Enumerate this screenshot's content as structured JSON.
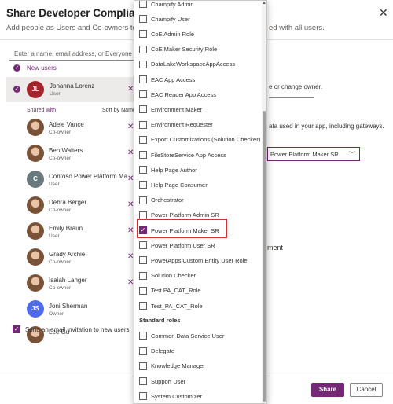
{
  "header": {
    "title": "Share Developer Compliance Cent",
    "subtitle_left": "Add people as Users and Co-owners to your app.",
    "subtitle_right": "ed with all users.",
    "close_glyph": "✕"
  },
  "people_panel": {
    "search_placeholder": "Enter a name, email address, or Everyone",
    "new_users_label": "New users",
    "selected_user": {
      "initials": "JL",
      "name": "Johanna Lorenz",
      "role": "User",
      "avatar_color": "#a4262c"
    },
    "shared_with_label": "Shared with",
    "sort_label": "Sort by Name",
    "shared": [
      {
        "name": "Adele Vance",
        "role": "Co-owner",
        "photo": true
      },
      {
        "name": "Ben Walters",
        "role": "Co-owner",
        "photo": true
      },
      {
        "name": "Contoso Power Platform Ma",
        "role": "User",
        "photo": false,
        "initials": "C",
        "avatar_color": "#69797e"
      },
      {
        "name": "Debra Berger",
        "role": "Co-owner",
        "photo": true
      },
      {
        "name": "Emily Braun",
        "role": "User",
        "photo": true
      },
      {
        "name": "Grady Archie",
        "role": "Co-owner",
        "photo": true
      },
      {
        "name": "Isaiah Langer",
        "role": "Co-owner",
        "photo": true
      },
      {
        "name": "Joni Sherman",
        "role": "Owner",
        "photo": false,
        "initials": "JS",
        "avatar_color": "#4f6bed"
      },
      {
        "name": "Lee Gu",
        "role": "",
        "photo": true
      }
    ],
    "email_invite_label": "Send an email invitation to new users",
    "remove_glyph": "✕"
  },
  "right_panel": {
    "text1": "e or change owner.",
    "text2": "ata used in your app, including gateways.",
    "selected_role": "Power Platform Maker SR",
    "partial_text": "ment"
  },
  "footer": {
    "share_label": "Share",
    "cancel_label": "Cancel"
  },
  "roles_dropdown": {
    "items": [
      {
        "label": "Champify Admin",
        "checked": false
      },
      {
        "label": "Champify User",
        "checked": false
      },
      {
        "label": "CoE Admin Role",
        "checked": false
      },
      {
        "label": "CoE Maker Security Role",
        "checked": false
      },
      {
        "label": "DataLakeWorkspaceAppAccess",
        "checked": false
      },
      {
        "label": "EAC App Access",
        "checked": false
      },
      {
        "label": "EAC Reader App Access",
        "checked": false
      },
      {
        "label": "Environment Maker",
        "checked": false
      },
      {
        "label": "Environment Requester",
        "checked": false
      },
      {
        "label": "Export Customizations (Solution Checker)",
        "checked": false
      },
      {
        "label": "FileStoreService App Access",
        "checked": false
      },
      {
        "label": "Help Page Author",
        "checked": false
      },
      {
        "label": "Help Page Consumer",
        "checked": false
      },
      {
        "label": "Orchestrator",
        "checked": false
      },
      {
        "label": "Power Platform Admin SR",
        "checked": false
      },
      {
        "label": "Power Platform Maker SR",
        "checked": true
      },
      {
        "label": "Power Platform User SR",
        "checked": false
      },
      {
        "label": "PowerApps Custom Entity User Role",
        "checked": false
      },
      {
        "label": "Solution Checker",
        "checked": false
      },
      {
        "label": "Test PA_CAT_Role",
        "checked": false
      },
      {
        "label": "Test_PA_CAT_Role",
        "checked": false
      }
    ],
    "standard_header": "Standard roles",
    "standard_items": [
      {
        "label": "Common Data Service User",
        "checked": false
      },
      {
        "label": "Delegate",
        "checked": false
      },
      {
        "label": "Knowledge Manager",
        "checked": false
      },
      {
        "label": "Support User",
        "checked": false
      },
      {
        "label": "System Customizer",
        "checked": false
      }
    ]
  }
}
